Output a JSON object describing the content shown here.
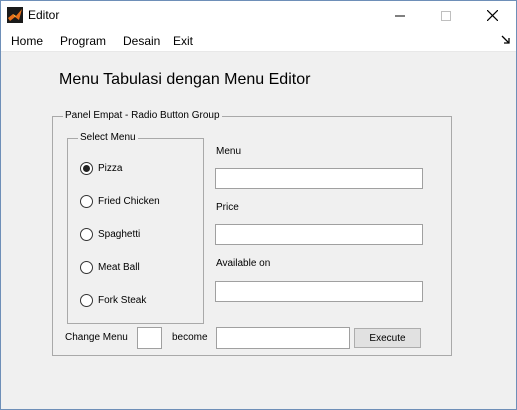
{
  "window": {
    "title": "Editor",
    "icon": "matlab-icon",
    "controls": {
      "minimize": "—",
      "maximize": "☐",
      "close": "✕"
    }
  },
  "menubar": {
    "items": [
      {
        "label": "Home"
      },
      {
        "label": "Program"
      },
      {
        "label": "Desain"
      },
      {
        "label": "Exit"
      }
    ]
  },
  "main": {
    "heading": "Menu Tabulasi dengan Menu Editor",
    "panel_title": "Panel Empat - Radio Button Group",
    "button_group": {
      "title": "Select Menu",
      "selected": "Pizza",
      "options": [
        {
          "label": "Pizza"
        },
        {
          "label": "Fried Chicken"
        },
        {
          "label": "Spaghetti"
        },
        {
          "label": "Meat Ball"
        },
        {
          "label": "Fork Steak"
        }
      ]
    },
    "fields": {
      "menu_label": "Menu",
      "menu_value": "",
      "price_label": "Price",
      "price_value": "",
      "available_label": "Available on",
      "available_value": ""
    },
    "change": {
      "label": "Change Menu",
      "value": "",
      "become_label": "become",
      "become_value": "",
      "execute_label": "Execute"
    }
  },
  "colors": {
    "border": "#6e8fb8",
    "background": "#f0f0f0"
  }
}
